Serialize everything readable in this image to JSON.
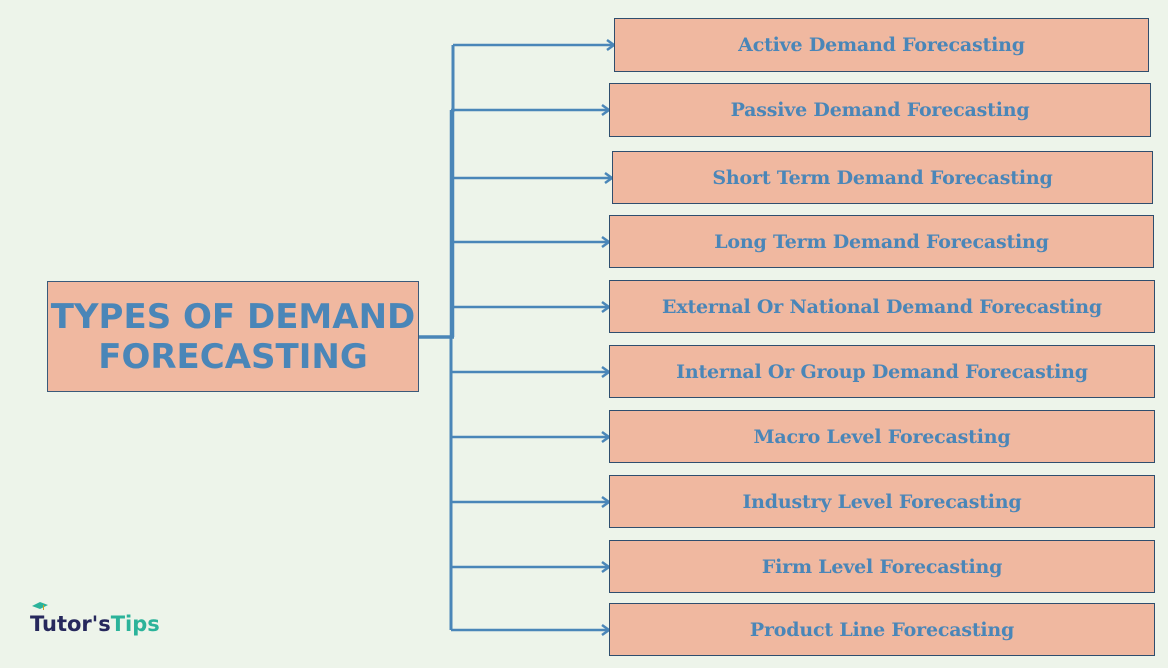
{
  "diagram": {
    "root": {
      "lines": [
        "TYPES OF DEMAND",
        "FORECASTING"
      ]
    },
    "items": [
      {
        "label": "Active Demand Forecasting"
      },
      {
        "label": "Passive Demand Forecasting"
      },
      {
        "label": "Short Term Demand Forecasting"
      },
      {
        "label": "Long Term Demand Forecasting"
      },
      {
        "label": "External Or National Demand Forecasting"
      },
      {
        "label": "Internal Or Group Demand Forecasting"
      },
      {
        "label": "Macro Level Forecasting"
      },
      {
        "label": "Industry Level Forecasting"
      },
      {
        "label": "Firm Level Forecasting"
      },
      {
        "label": "Product Line Forecasting"
      }
    ],
    "colors": {
      "background": "#edf4ea",
      "box_fill": "#f0b8a0",
      "text": "#4a86b8",
      "connector": "#4a86b8"
    }
  },
  "logo": {
    "part1": "Tutor's",
    "part2": "Tips",
    "icon": "graduation-cap-icon"
  }
}
